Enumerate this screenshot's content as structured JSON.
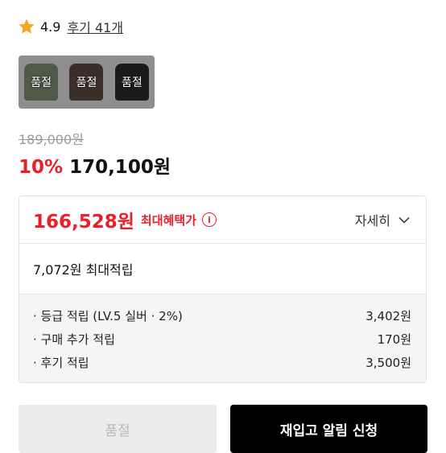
{
  "rating": {
    "icon": "star-icon",
    "score": "4.9",
    "reviews_label": "후기 41개",
    "star_color": "#f5a623"
  },
  "swatches": [
    {
      "label": "품절",
      "color": "#4f5a49"
    },
    {
      "label": "품절",
      "color": "#3a2f29"
    },
    {
      "label": "품절",
      "color": "#1b1b1b"
    }
  ],
  "price": {
    "original": "189,000원",
    "discount_pct": "10%",
    "sale": "170,100원",
    "accent_color": "#e8202a"
  },
  "benefit": {
    "max_price": "166,528원",
    "max_label": "최대혜택가",
    "info_icon_glyph": "i",
    "detail_label": "자세히",
    "points_total": "7,072원 최대적립",
    "items": [
      {
        "label": "· 등급 적립 (LV.5 실버 · 2%)",
        "value": "3,402원"
      },
      {
        "label": "· 구매 추가 적립",
        "value": "170원"
      },
      {
        "label": "· 후기 적립",
        "value": "3,500원"
      }
    ]
  },
  "buttons": {
    "soldout": "품절",
    "restock": "재입고 알림 신청"
  }
}
